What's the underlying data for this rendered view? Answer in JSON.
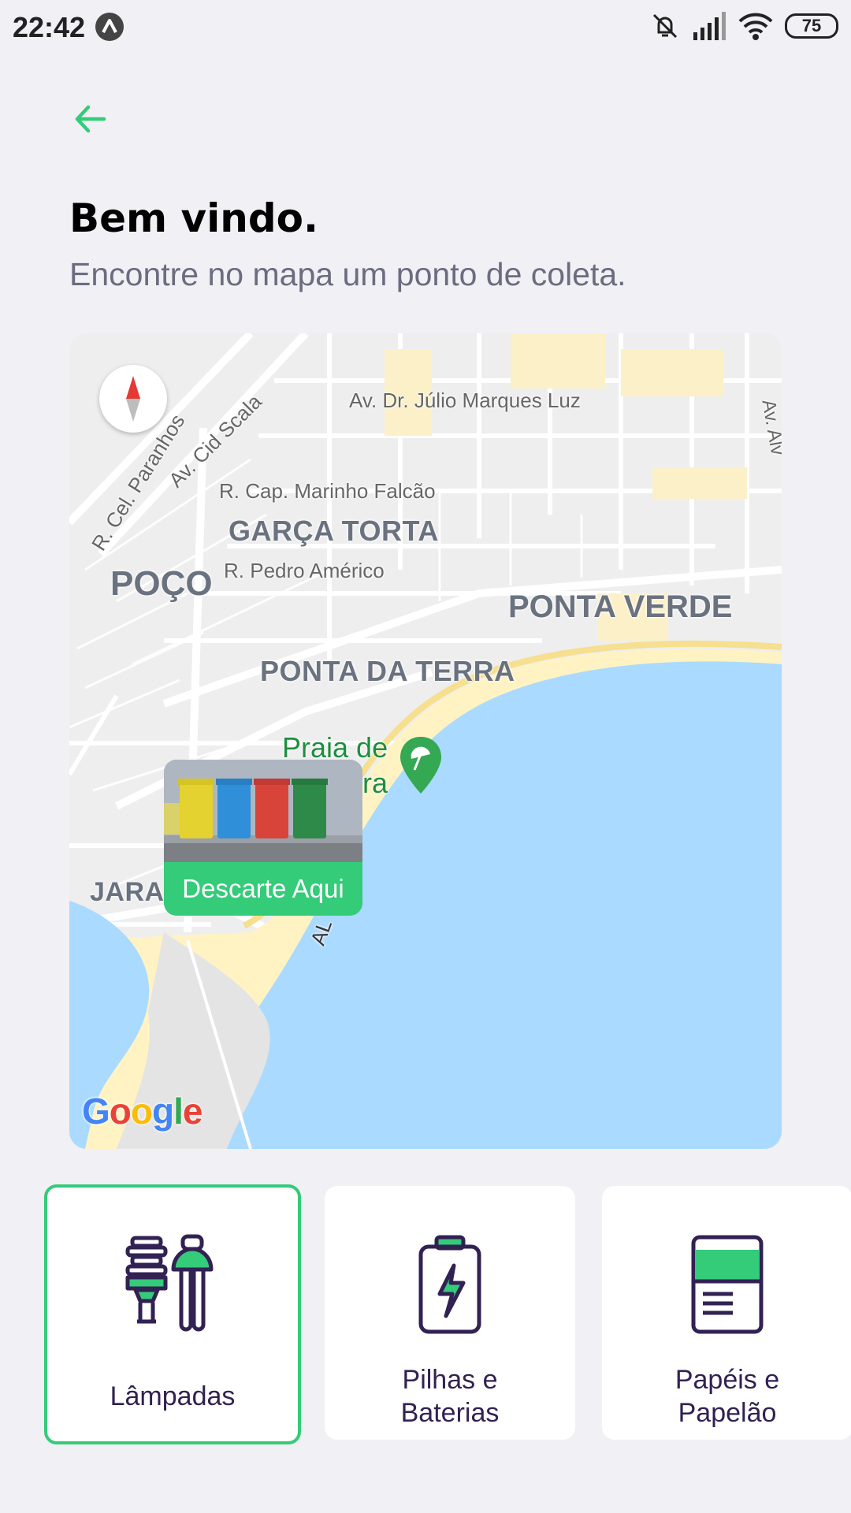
{
  "status_bar": {
    "time": "22:42",
    "battery": "75",
    "icons": [
      "app-notification-icon",
      "mute-icon",
      "signal-icon",
      "wifi-icon",
      "battery-icon"
    ]
  },
  "header": {
    "back_icon": "arrow-left-icon",
    "title": "Bem vindo.",
    "subtitle": "Encontre no mapa um ponto de coleta."
  },
  "map": {
    "labels": {
      "av_julio": "Av. Dr. Júlio Marques Luz",
      "av_cid": "Av. Cid Scala",
      "r_cel": "R. Cel. Paranhos",
      "r_cap": "R. Cap. Marinho Falcão",
      "garca": "GARÇA TORTA",
      "poco": "POÇO",
      "r_pedro": "R. Pedro Américo",
      "ponta_verde": "PONTA VERDE",
      "ponta_terra": "PONTA DA TERRA",
      "praia_1": "Praia de",
      "praia_2": "ra",
      "jara": "JARA",
      "av_right": "Av. Alv",
      "al": "AL"
    },
    "marker": {
      "label": "Descarte Aqui"
    },
    "attribution": "Google",
    "colors": {
      "water": "#AADAFF",
      "land": "#EEEEEE",
      "beach": "#FFF3C4",
      "marker_bg": "#34CB79"
    }
  },
  "items": [
    {
      "label_1": "Lâmpadas",
      "label_2": "",
      "icon": "lamps-icon",
      "selected": true
    },
    {
      "label_1": "Pilhas e",
      "label_2": "Baterias",
      "icon": "battery-charge-icon",
      "selected": false
    },
    {
      "label_1": "Papéis e",
      "label_2": "Papelão",
      "icon": "paper-icon",
      "selected": false
    }
  ],
  "colors": {
    "accent": "#34CB79",
    "title": "#000000",
    "subtitle": "#6C6C80",
    "background": "#F0F0F5",
    "icon_stroke": "#322153"
  }
}
